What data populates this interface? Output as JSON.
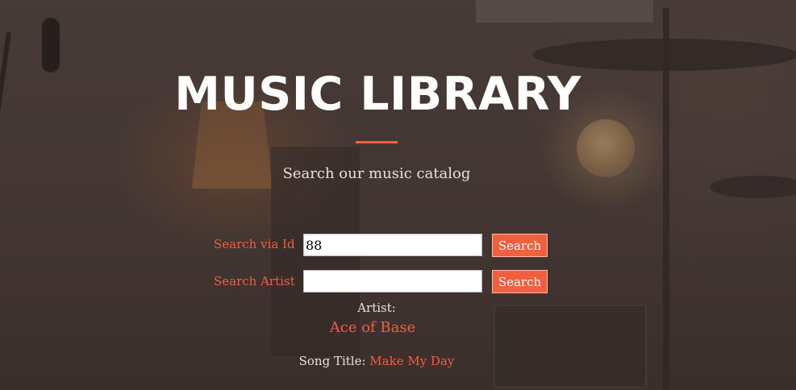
{
  "header": {
    "title": "MUSIC LIBRARY",
    "subtitle": "Search our music catalog"
  },
  "search_by_id": {
    "label": "Search via Id",
    "value": "88",
    "button_label": "Search"
  },
  "search_by_artist": {
    "label": "Search Artist",
    "value": "",
    "button_label": "Search"
  },
  "result": {
    "artist_label": "Artist:",
    "artist_value": "Ace of Base",
    "song_title_label": "Song Title:",
    "song_title_value": "Make My Day"
  },
  "colors": {
    "accent": "#f05f40",
    "text": "#ffffff"
  }
}
